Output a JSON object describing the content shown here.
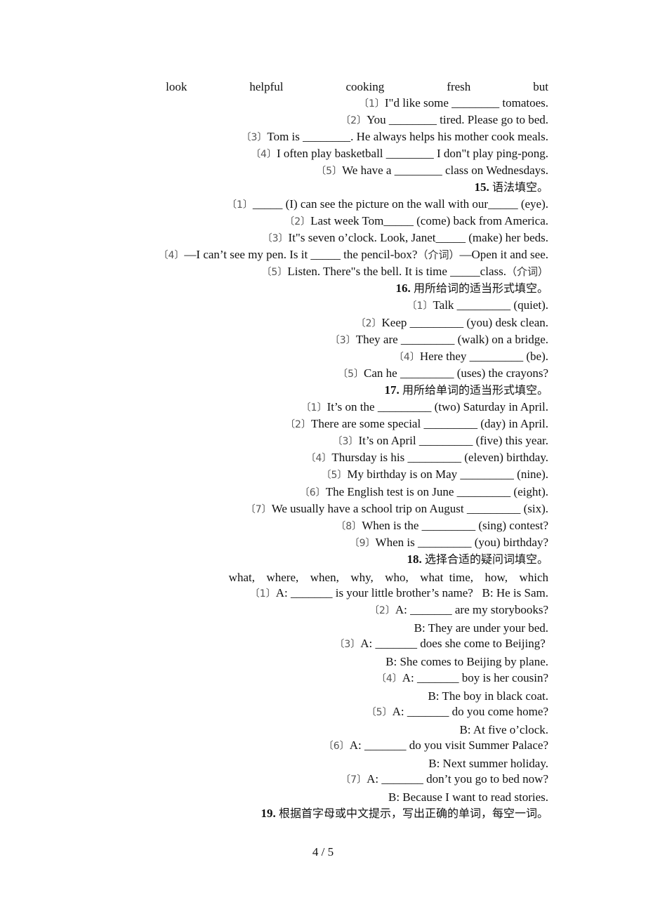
{
  "page": {
    "number": "4 / 5"
  },
  "section14": {
    "word_bank": "look    helpful    cooking    fresh    but",
    "items": [
      {
        "num": "〔1〕",
        "text": "I\"d like some ________ tomatoes."
      },
      {
        "num": "〔2〕",
        "text": "You ________ tired. Please go to bed."
      },
      {
        "num": "〔3〕",
        "text": "Tom is ________. He always helps his mother cook meals."
      },
      {
        "num": "〔4〕",
        "text": "I often play basketball ________ I don\"t play ping-pong."
      },
      {
        "num": "〔5〕",
        "text": "We have a ________ class on Wednesdays."
      }
    ]
  },
  "section15": {
    "number": "15.",
    "title": "语法填空。",
    "items": [
      {
        "num": "〔1〕",
        "text": "_____ (I) can see the picture on the wall with our_____ (eye)."
      },
      {
        "num": "〔2〕",
        "text": "Last week Tom_____ (come) back from America."
      },
      {
        "num": "〔3〕",
        "text": "It\"s seven o’clock. Look, Janet_____ (make) her beds."
      },
      {
        "num": "〔4〕",
        "text": "—I can’t see my pen. Is it _____ the pencil-box?",
        "hint": "（介词）",
        "tail": "—Open it and see."
      },
      {
        "num": "〔5〕",
        "text": "Listen. There\"s the bell. It is time _____class.",
        "hint": "（介词）",
        "tail": ""
      }
    ]
  },
  "section16": {
    "number": "16.",
    "title": "用所给词的适当形式填空。",
    "items": [
      {
        "num": "〔1〕",
        "text": "Talk _________ (quiet)."
      },
      {
        "num": "〔2〕",
        "text": "Keep _________ (you) desk clean."
      },
      {
        "num": "〔3〕",
        "text": "They are _________ (walk) on a bridge."
      },
      {
        "num": "〔4〕",
        "text": "Here they _________ (be)."
      },
      {
        "num": "〔5〕",
        "text": "Can he _________ (uses) the crayons?"
      }
    ]
  },
  "section17": {
    "number": "17.",
    "title": "用所给单词的适当形式填空。",
    "items": [
      {
        "num": "〔1〕",
        "text": "It’s on the _________ (two) Saturday in April."
      },
      {
        "num": "〔2〕",
        "text": "There are some special _________ (day) in April."
      },
      {
        "num": "〔3〕",
        "text": "It’s on April _________ (five) this year."
      },
      {
        "num": "〔4〕",
        "text": "Thursday is his _________ (eleven) birthday."
      },
      {
        "num": "〔5〕",
        "text": "My birthday is on May _________ (nine)."
      },
      {
        "num": "〔6〕",
        "text": "The English test is on June _________ (eight)."
      },
      {
        "num": "〔7〕",
        "text": "We usually have a school trip on August _________ (six)."
      },
      {
        "num": "〔8〕",
        "text": "When is the _________ (sing) contest?"
      },
      {
        "num": "〔9〕",
        "text": "When is _________ (you) birthday?"
      }
    ]
  },
  "section18": {
    "number": "18.",
    "title": "选择合适的疑问词填空。",
    "word_bank": "what,  where,  when,  why,  who,  what time,  how,  which",
    "lines": [
      {
        "num": "〔1〕",
        "text": "A: _______ is your little brother’s name?   B: He is Sam."
      },
      {
        "num": "〔2〕",
        "text": "A: _______ are my storybooks?"
      },
      {
        "num": "",
        "text": "B: They are under your bed."
      },
      {
        "num": "〔3〕",
        "text": "A: _______ does she come to Beijing? "
      },
      {
        "num": "",
        "text": "B: She comes to Beijing by plane."
      },
      {
        "num": "〔4〕",
        "text": "A: _______ boy is her cousin?"
      },
      {
        "num": "",
        "text": "B: The boy in black coat."
      },
      {
        "num": "〔5〕",
        "text": "A: _______ do you come home?"
      },
      {
        "num": "",
        "text": "B: At five o’clock."
      },
      {
        "num": "〔6〕",
        "text": "A: _______ do you visit Summer Palace?"
      },
      {
        "num": "",
        "text": "B: Next summer holiday."
      },
      {
        "num": "〔7〕",
        "text": "A: _______ don’t you go to bed now?"
      },
      {
        "num": "",
        "text": "B: Because I want to read stories."
      }
    ]
  },
  "section19": {
    "number": "19.",
    "title": "根据首字母或中文提示，写出正确的单词，每空一词。"
  }
}
